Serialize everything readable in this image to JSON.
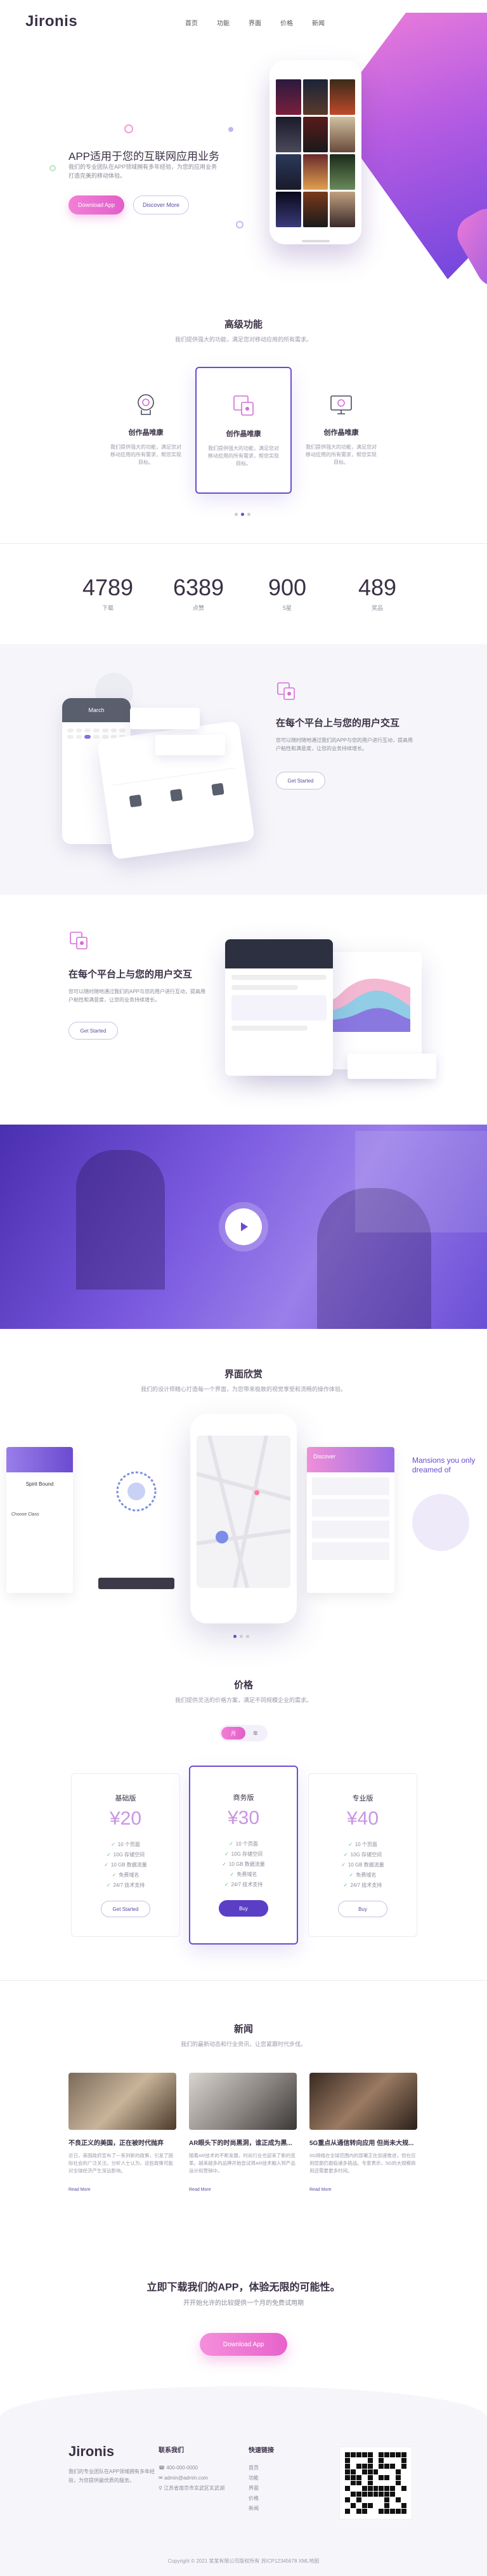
{
  "brand": {
    "logo": "Jironis"
  },
  "nav": [
    "首页",
    "功能",
    "界面",
    "价格",
    "新闻"
  ],
  "hero": {
    "title": "APP适用于您的互联网应用业务",
    "subtitle": "我们的专业团队在APP领域拥有多年经验，为您的应用业务打造完美的移动体验。",
    "primary_btn": "Download App",
    "secondary_btn": "Discover More"
  },
  "features": {
    "title": "高级功能",
    "subtitle": "我们提供强大的功能，满足您对移动应用的所有需求。",
    "cards": [
      {
        "name": "创作晶唯康",
        "desc": "我们提供强大的功能，满足您对移动应用的所有需求，帮您实现目标。",
        "icon": "brain-icon"
      },
      {
        "name": "创作晶唯康",
        "desc": "我们提供强大的功能，满足您对移动应用的所有需求，帮您实现目标。",
        "icon": "devices-icon"
      },
      {
        "name": "创作晶唯康",
        "desc": "我们提供强大的功能，满足您对移动应用的所有需求，帮您实现目标。",
        "icon": "monitor-icon"
      }
    ]
  },
  "stats": [
    {
      "num": "4789",
      "label": "下载"
    },
    {
      "num": "6389",
      "label": "点赞"
    },
    {
      "num": "900",
      "label": "5星"
    },
    {
      "num": "489",
      "label": "奖品"
    }
  ],
  "interaction1": {
    "title": "在每个平台上与您的用户交互",
    "desc": "您可以随时随地通过我们的APP与您的用户进行互动，提高用户粘性和满意度，让您的业务持续增长。",
    "btn": "Get Started",
    "phone_month": "March"
  },
  "interaction2": {
    "title": "在每个平台上与您的用户交互",
    "desc": "您可以随时随地通过我们的APP与您的用户进行互动，提高用户粘性和满意度，让您的业务持续增长。",
    "btn": "Get Started"
  },
  "screens": {
    "title": "界面欣赏",
    "subtitle": "我们的设计师精心打造每一个界面，为您带来极致的视觉享受和流畅的操作体验。",
    "discover": "Discover",
    "right_text": "Mansions you only dreamed of",
    "profile_name": "Spirit Bound",
    "left_tag": "Choose Class"
  },
  "pricing": {
    "title": "价格",
    "subtitle": "我们提供灵活的价格方案，满足不同规模企业的需求。",
    "toggle": [
      "月",
      "年"
    ],
    "plans": [
      {
        "name": "基础版",
        "price": "¥20",
        "features": [
          "10 个页面",
          "10G 存储空间",
          "10 GB 数据流量",
          "免费域名",
          "24/7 技术支持"
        ],
        "btn": "Get Started"
      },
      {
        "name": "商务版",
        "price": "¥30",
        "features": [
          "10 个页面",
          "10G 存储空间",
          "10 GB 数据流量",
          "免费域名",
          "24/7 技术支持"
        ],
        "btn": "Buy"
      },
      {
        "name": "专业版",
        "price": "¥40",
        "features": [
          "10 个页面",
          "10G 存储空间",
          "10 GB 数据流量",
          "免费域名",
          "24/7 技术支持"
        ],
        "btn": "Buy"
      }
    ]
  },
  "news": {
    "title": "新闻",
    "subtitle": "我们的最新动态和行业资讯，让您紧跟时代步伐。",
    "items": [
      {
        "title": "不良正义的美国，正在被时代抛弃",
        "text": "近日，美国政府宣布了一系列新的政策，引发了国际社会的广泛关注。分析人士认为，这些政策可能对全球经济产生深远影响。",
        "more": "Read More"
      },
      {
        "title": "AR眼头下的时尚黑洞，谁正成为黑...",
        "text": "随着AR技术的不断发展，时尚行业也迎来了新的变革。越来越多的品牌开始尝试将AR技术融入到产品设计和营销中。",
        "more": "Read More"
      },
      {
        "title": "5G重点从通信转向应用 但尚未大规...",
        "text": "5G网络在全球范围内的部署正在加速推进，但在应用层面仍面临诸多挑战。专家表示，5G的大规模商用还需要更多时间。",
        "more": "Read More"
      }
    ]
  },
  "cta": {
    "title": "立即下载我们的APP，体验无限的可能性。",
    "subtitle": "开开始允许的比较提供一个月的免费试用期",
    "btn": "Download App"
  },
  "footer": {
    "logo": "Jironis",
    "about": "我们的专业团队在APP领域拥有多年经验，为您提供最优质的服务。",
    "contact_title": "联系我们",
    "contact": [
      "400-000-0000",
      "admin@admin.com",
      "江苏省南京市玄武区玄武湖"
    ],
    "links_title": "快速链接",
    "links": [
      "首页",
      "功能",
      "界面",
      "价格",
      "新闻"
    ],
    "copyright": "Copyright © 2021 某某有限公司版权所有  苏ICP12345678  XML地图"
  },
  "colors": {
    "accent": "#6b4bd0",
    "pink": "#e86fd2",
    "grad_start": "#f07ad6",
    "grad_end": "#5e3bd6"
  }
}
